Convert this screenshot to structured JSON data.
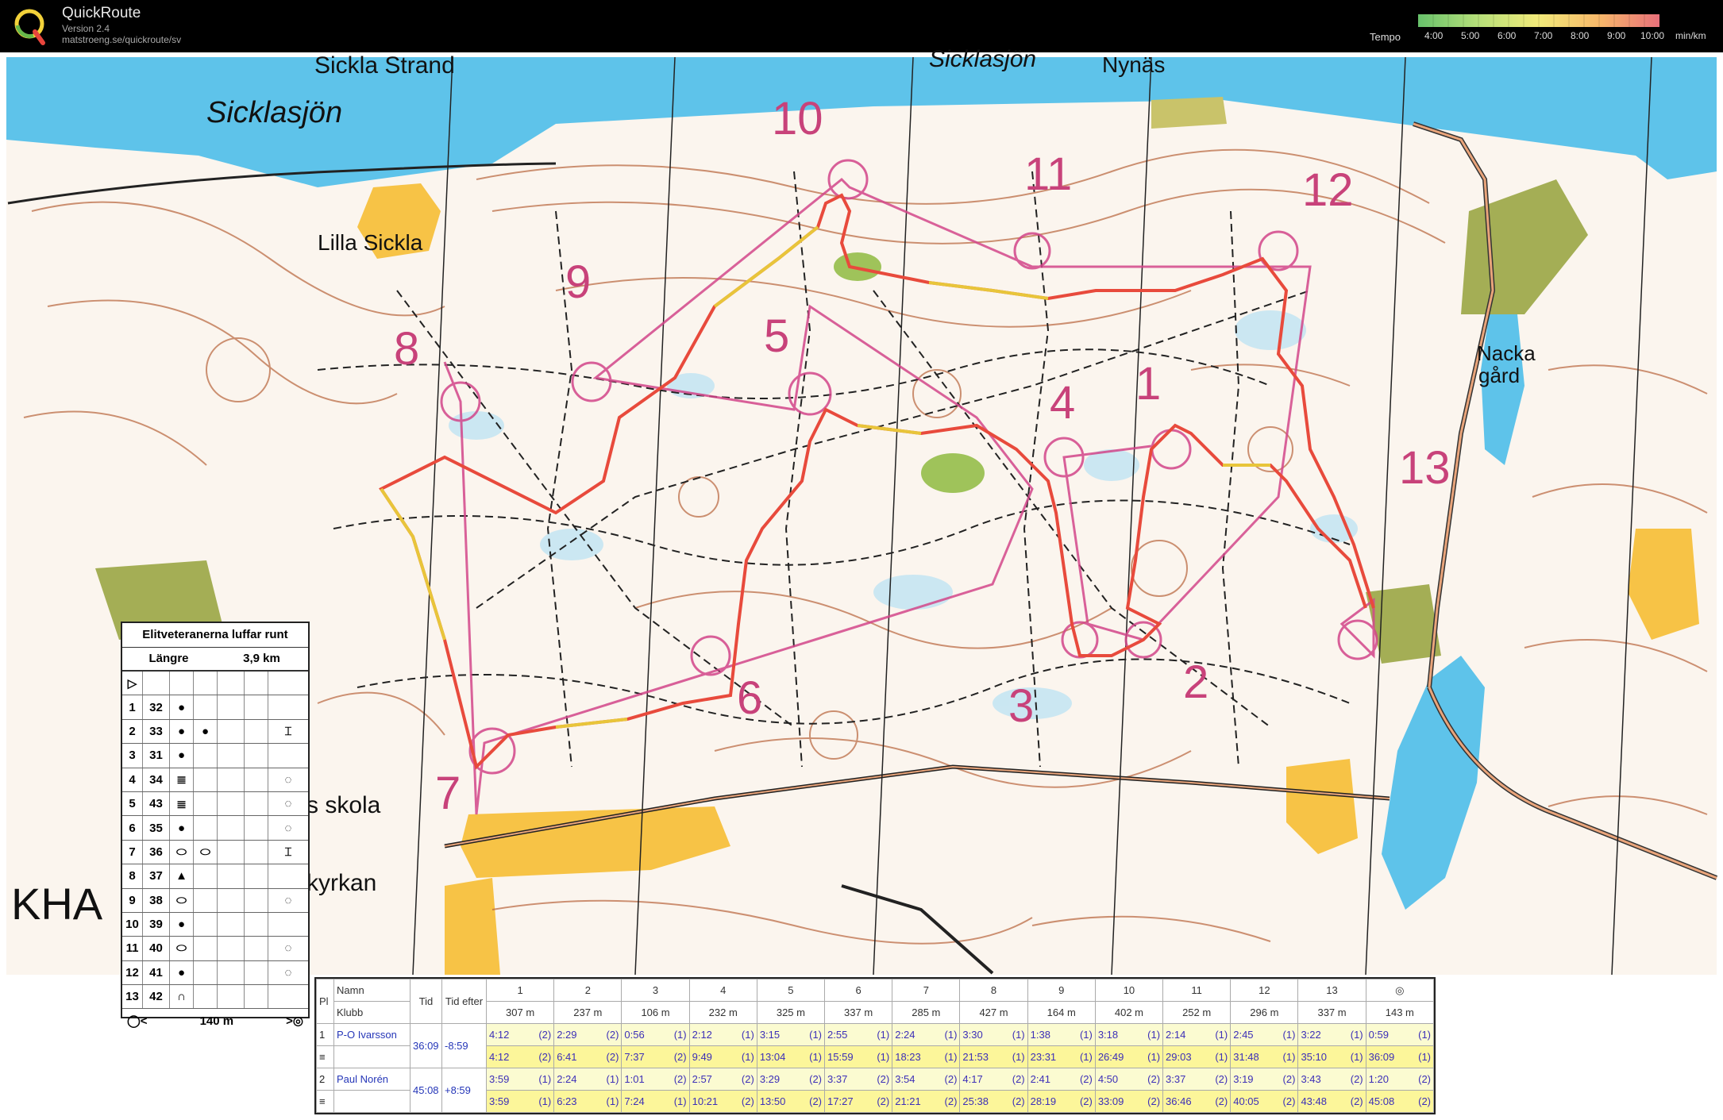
{
  "header": {
    "app_name": "QuickRoute",
    "version": "Version 2.4",
    "url": "matstroeng.se/quickroute/sv",
    "tempo_label": "Tempo",
    "tempo_ticks": [
      "4:00",
      "5:00",
      "6:00",
      "7:00",
      "8:00",
      "9:00",
      "10:00",
      "min/km"
    ],
    "tempo_colors": [
      "#67c16b",
      "#b7e07a",
      "#f2ea7a",
      "#f7b86a",
      "#e8707a"
    ]
  },
  "map": {
    "places": [
      "Sickla Strand",
      "Sicklasjön",
      "Sicklasjön",
      "Nynäs",
      "Lilla Sickla",
      "Nacka",
      "gård",
      "s skola",
      "kyrkan",
      "KHA"
    ],
    "control_numbers": [
      "10",
      "11",
      "12",
      "9",
      "8",
      "5",
      "4",
      "1",
      "13",
      "6",
      "3",
      "2",
      "7"
    ],
    "colors": {
      "water": "#5ec3ea",
      "route_fast": "#e84a3c",
      "route_slow": "#d8d43a",
      "course": "#d2468a",
      "contour": "#b8643c",
      "open": "#f7c346",
      "vegetation": "#9fc35a"
    }
  },
  "description": {
    "title": "Elitveteranerna luffar runt",
    "course": "Längre",
    "length": "3,9 km",
    "controls": [
      {
        "seq": "1",
        "code": "32",
        "a": "●",
        "b": "",
        "c": "",
        "d": "",
        "e": ""
      },
      {
        "seq": "2",
        "code": "33",
        "a": "●",
        "b": "●",
        "c": "",
        "d": "",
        "e": "⌶"
      },
      {
        "seq": "3",
        "code": "31",
        "a": "●",
        "b": "",
        "c": "",
        "d": "",
        "e": ""
      },
      {
        "seq": "4",
        "code": "34",
        "a": "≣",
        "b": "",
        "c": "",
        "d": "",
        "e": "◌"
      },
      {
        "seq": "5",
        "code": "43",
        "a": "≣",
        "b": "",
        "c": "",
        "d": "",
        "e": "◌"
      },
      {
        "seq": "6",
        "code": "35",
        "a": "●",
        "b": "",
        "c": "",
        "d": "",
        "e": "◌"
      },
      {
        "seq": "7",
        "code": "36",
        "a": "⬭",
        "b": "⬭",
        "c": "",
        "d": "",
        "e": "⌶"
      },
      {
        "seq": "8",
        "code": "37",
        "a": "▲",
        "b": "",
        "c": "",
        "d": "",
        "e": ""
      },
      {
        "seq": "9",
        "code": "38",
        "a": "⬭",
        "b": "",
        "c": "",
        "d": "",
        "e": "◌"
      },
      {
        "seq": "10",
        "code": "39",
        "a": "●",
        "b": "",
        "c": "",
        "d": "",
        "e": ""
      },
      {
        "seq": "11",
        "code": "40",
        "a": "⬭",
        "b": "",
        "c": "",
        "d": "",
        "e": "◌"
      },
      {
        "seq": "12",
        "code": "41",
        "a": "●",
        "b": "",
        "c": "",
        "d": "",
        "e": "◌"
      },
      {
        "seq": "13",
        "code": "42",
        "a": "∩",
        "b": "",
        "c": "",
        "d": "",
        "e": ""
      }
    ],
    "start_symbol": "▷",
    "finish_length": "140 m"
  },
  "splits": {
    "headers": {
      "pl": "Pl",
      "name": "Namn",
      "club": "Klubb",
      "time": "Tid",
      "behind": "Tid efter"
    },
    "legs": [
      {
        "n": "1",
        "dist": "307 m"
      },
      {
        "n": "2",
        "dist": "237 m"
      },
      {
        "n": "3",
        "dist": "106 m"
      },
      {
        "n": "4",
        "dist": "232 m"
      },
      {
        "n": "5",
        "dist": "325 m"
      },
      {
        "n": "6",
        "dist": "337 m"
      },
      {
        "n": "7",
        "dist": "285 m"
      },
      {
        "n": "8",
        "dist": "427 m"
      },
      {
        "n": "9",
        "dist": "164 m"
      },
      {
        "n": "10",
        "dist": "402 m"
      },
      {
        "n": "11",
        "dist": "252 m"
      },
      {
        "n": "12",
        "dist": "296 m"
      },
      {
        "n": "13",
        "dist": "337 m"
      },
      {
        "n": "◎",
        "dist": "143 m"
      }
    ],
    "runners": [
      {
        "place": "1",
        "name": "P-O Ivarsson",
        "time": "36:09",
        "behind": "-8:59",
        "split": [
          [
            "4:12",
            "(2)"
          ],
          [
            "2:29",
            "(2)"
          ],
          [
            "0:56",
            "(1)"
          ],
          [
            "2:12",
            "(1)"
          ],
          [
            "3:15",
            "(1)"
          ],
          [
            "2:55",
            "(1)"
          ],
          [
            "2:24",
            "(1)"
          ],
          [
            "3:30",
            "(1)"
          ],
          [
            "1:38",
            "(1)"
          ],
          [
            "3:18",
            "(1)"
          ],
          [
            "2:14",
            "(1)"
          ],
          [
            "2:45",
            "(1)"
          ],
          [
            "3:22",
            "(1)"
          ],
          [
            "0:59",
            "(1)"
          ]
        ],
        "cumul": [
          [
            "4:12",
            "(2)"
          ],
          [
            "6:41",
            "(2)"
          ],
          [
            "7:37",
            "(2)"
          ],
          [
            "9:49",
            "(1)"
          ],
          [
            "13:04",
            "(1)"
          ],
          [
            "15:59",
            "(1)"
          ],
          [
            "18:23",
            "(1)"
          ],
          [
            "21:53",
            "(1)"
          ],
          [
            "23:31",
            "(1)"
          ],
          [
            "26:49",
            "(1)"
          ],
          [
            "29:03",
            "(1)"
          ],
          [
            "31:48",
            "(1)"
          ],
          [
            "35:10",
            "(1)"
          ],
          [
            "36:09",
            "(1)"
          ]
        ]
      },
      {
        "place": "2",
        "name": "Paul Norén",
        "time": "45:08",
        "behind": "+8:59",
        "split": [
          [
            "3:59",
            "(1)"
          ],
          [
            "2:24",
            "(1)"
          ],
          [
            "1:01",
            "(2)"
          ],
          [
            "2:57",
            "(2)"
          ],
          [
            "3:29",
            "(2)"
          ],
          [
            "3:37",
            "(2)"
          ],
          [
            "3:54",
            "(2)"
          ],
          [
            "4:17",
            "(2)"
          ],
          [
            "2:41",
            "(2)"
          ],
          [
            "4:50",
            "(2)"
          ],
          [
            "3:37",
            "(2)"
          ],
          [
            "3:19",
            "(2)"
          ],
          [
            "3:43",
            "(2)"
          ],
          [
            "1:20",
            "(2)"
          ]
        ],
        "cumul": [
          [
            "3:59",
            "(1)"
          ],
          [
            "6:23",
            "(1)"
          ],
          [
            "7:24",
            "(1)"
          ],
          [
            "10:21",
            "(2)"
          ],
          [
            "13:50",
            "(2)"
          ],
          [
            "17:27",
            "(2)"
          ],
          [
            "21:21",
            "(2)"
          ],
          [
            "25:38",
            "(2)"
          ],
          [
            "28:19",
            "(2)"
          ],
          [
            "33:09",
            "(2)"
          ],
          [
            "36:46",
            "(2)"
          ],
          [
            "40:05",
            "(2)"
          ],
          [
            "43:48",
            "(2)"
          ],
          [
            "45:08",
            "(2)"
          ]
        ]
      }
    ]
  }
}
